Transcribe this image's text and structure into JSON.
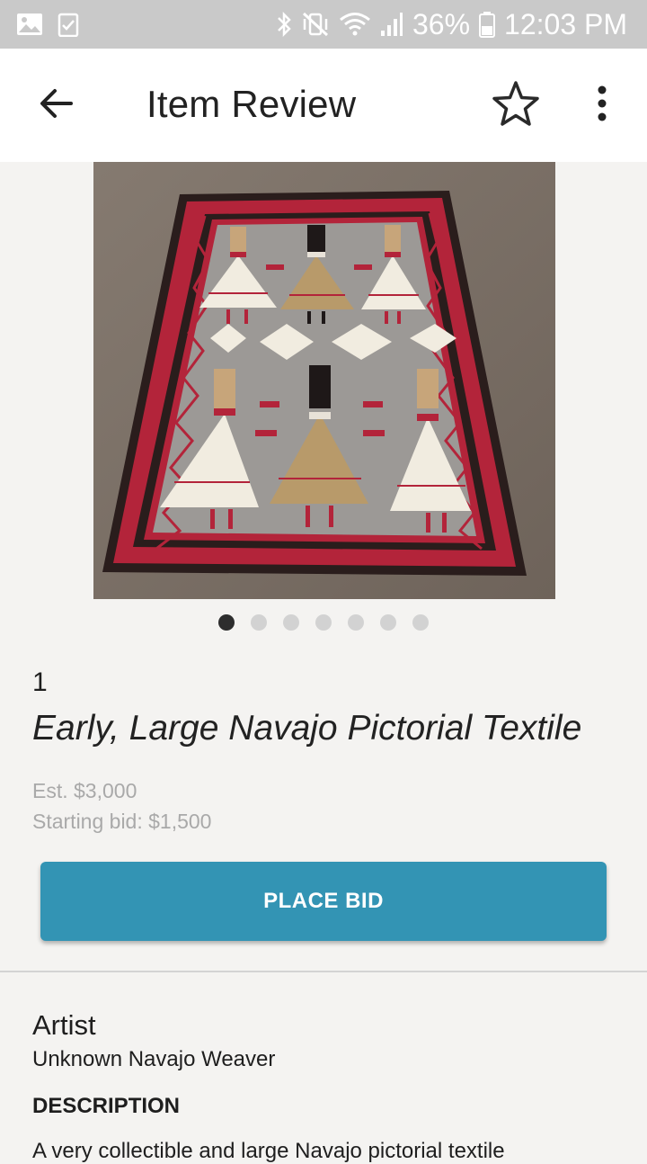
{
  "status_bar": {
    "battery": "36%",
    "time": "12:03 PM",
    "icons": [
      "gallery-icon",
      "clipboard-check-icon",
      "bluetooth-icon",
      "vibrate-mute-icon",
      "wifi-icon",
      "signal-icon",
      "battery-icon"
    ]
  },
  "app_bar": {
    "title": "Item Review",
    "back_icon": "arrow-back-icon",
    "favorite_icon": "star-outline-icon",
    "more_icon": "more-vert-icon"
  },
  "gallery": {
    "image_description": "Navajo pictorial textile with figures",
    "count": 7,
    "active_index": 0
  },
  "item": {
    "lot_number": "1",
    "title": "Early, Large Navajo Pictorial Textile",
    "estimate": "Est. $3,000",
    "starting_bid": "Starting bid: $1,500"
  },
  "actions": {
    "place_bid": "PLACE BID"
  },
  "details": {
    "artist_label": "Artist",
    "artist_value": "Unknown Navajo Weaver",
    "description_label": "DESCRIPTION",
    "description_text": "A very collectible and large Navajo pictorial textile"
  },
  "colors": {
    "accent": "#3394b4",
    "status_bar": "#c9c9c9",
    "background": "#f4f3f1"
  }
}
